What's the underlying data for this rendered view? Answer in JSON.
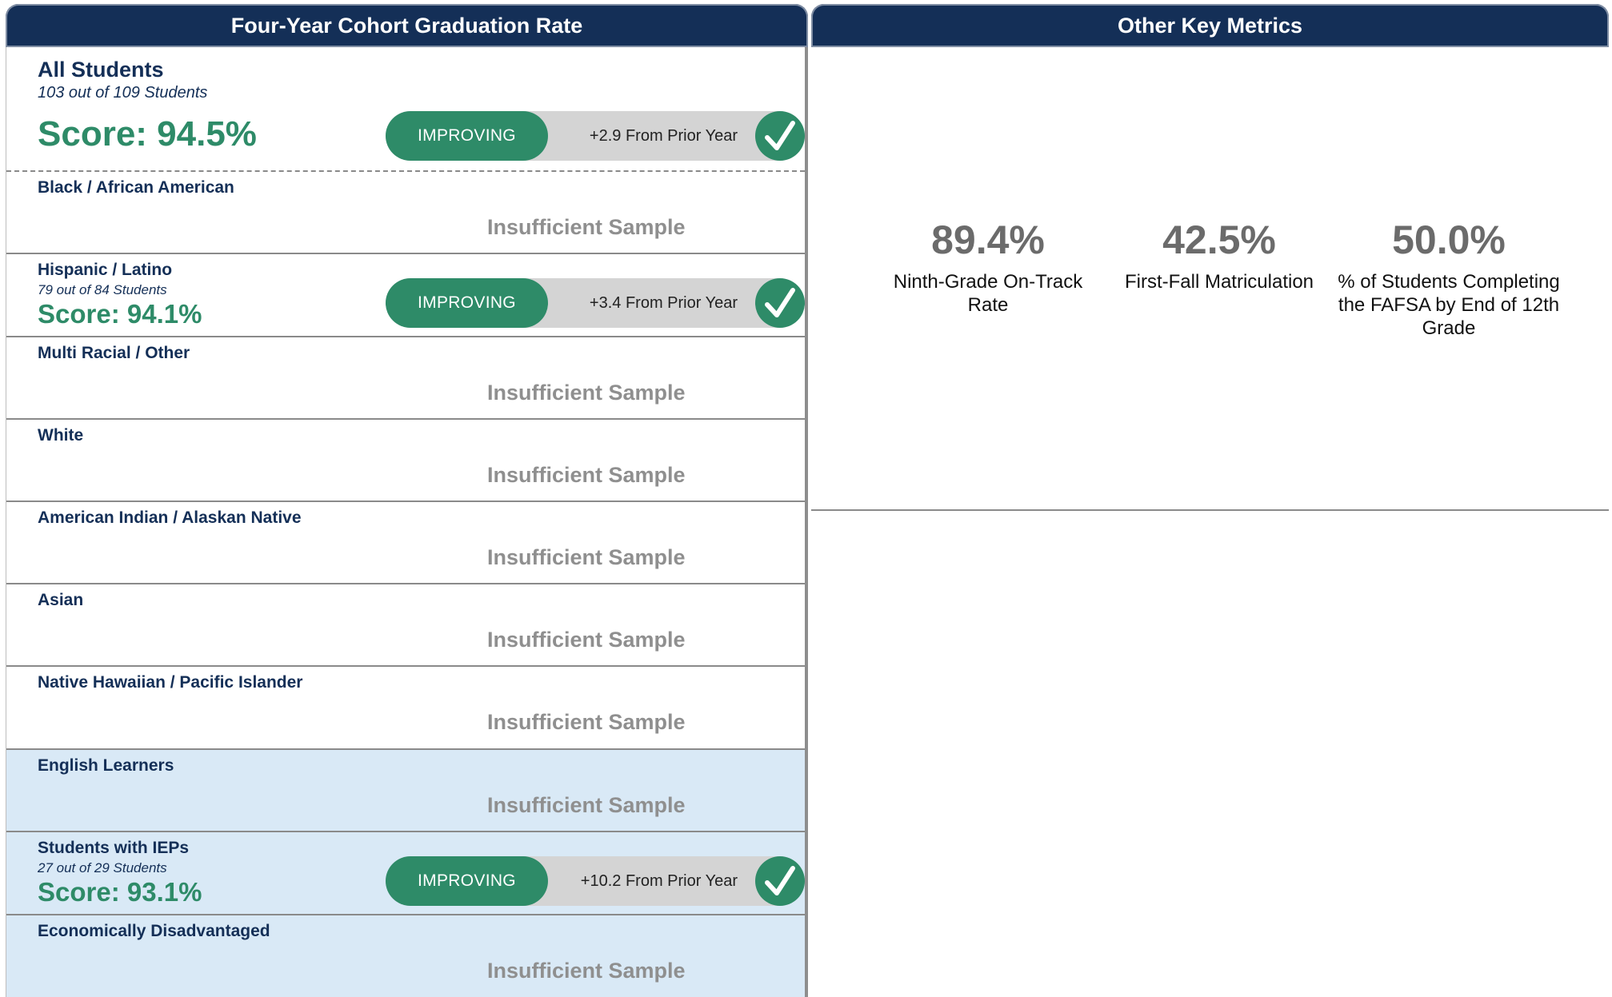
{
  "left_panel": {
    "title": "Four-Year Cohort Graduation Rate"
  },
  "right_panel": {
    "title": "Other Key Metrics"
  },
  "groups": [
    {
      "name": "All Students",
      "count": "103 out of 109 Students",
      "score": "Score: 94.5%",
      "status": "IMPROVING",
      "change": "+2.9 From Prior Year"
    },
    {
      "name": "Black / African American",
      "status": "Insufficient Sample"
    },
    {
      "name": "Hispanic / Latino",
      "count": "79 out of 84 Students",
      "score": "Score: 94.1%",
      "status": "IMPROVING",
      "change": "+3.4 From Prior Year"
    },
    {
      "name": "Multi Racial / Other",
      "status": "Insufficient Sample"
    },
    {
      "name": "White",
      "status": "Insufficient Sample"
    },
    {
      "name": "American Indian / Alaskan Native",
      "status": "Insufficient Sample"
    },
    {
      "name": "Asian",
      "status": "Insufficient Sample"
    },
    {
      "name": "Native Hawaiian / Pacific Islander",
      "status": "Insufficient Sample"
    },
    {
      "name": "English Learners",
      "status": "Insufficient Sample"
    },
    {
      "name": "Students with IEPs",
      "count": "27 out of 29 Students",
      "score": "Score: 93.1%",
      "status": "IMPROVING",
      "change": "+10.2 From Prior Year"
    },
    {
      "name": "Economically Disadvantaged",
      "status": "Insufficient Sample"
    }
  ],
  "metrics": [
    {
      "value": "89.4%",
      "label": "Ninth-Grade On-Track Rate"
    },
    {
      "value": "42.5%",
      "label": "First-Fall Matriculation"
    },
    {
      "value": "50.0%",
      "label": "% of Students Completing the FAFSA by End of 12th Grade"
    }
  ],
  "colors": {
    "header": "#142f57",
    "improving": "#2e8b68",
    "highlight_row": "#d9e9f6",
    "insufficient": "#8f8f8f"
  },
  "icons": {
    "status_ok": "check-icon"
  }
}
